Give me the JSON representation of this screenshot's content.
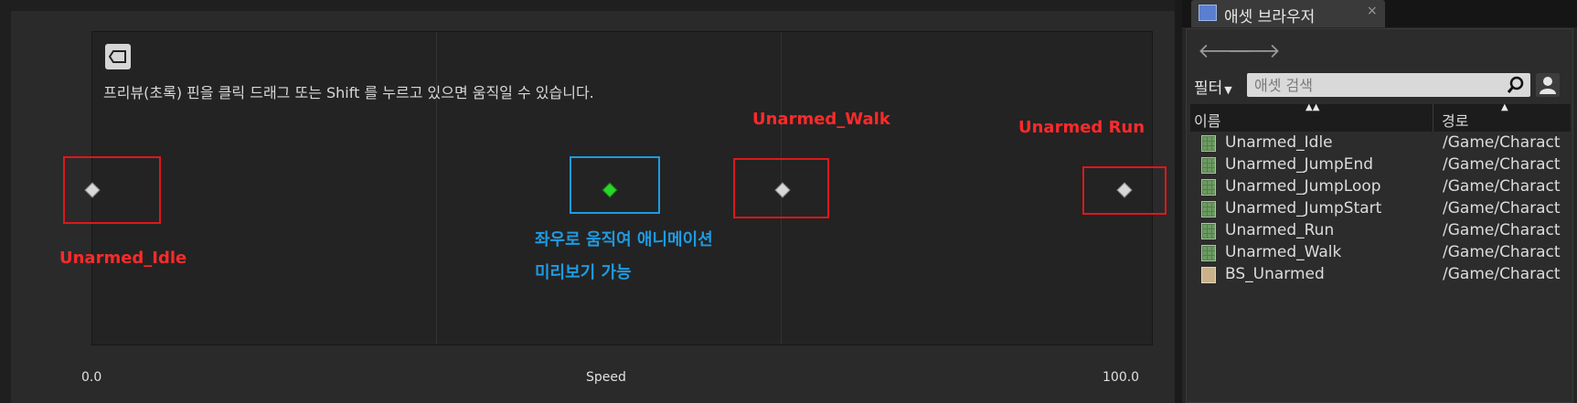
{
  "editor": {
    "hint_text": "프리뷰(초록) 핀을 클릭 드래그 또는 Shift 를 누르고 있으면 움직일 수 있습니다.",
    "hint_icon": "tag-icon",
    "axis": {
      "min_label": "0.0",
      "name": "Speed",
      "max_label": "100.0",
      "min": 0.0,
      "max": 100.0
    },
    "samples": [
      {
        "name": "Unarmed_Idle",
        "speed": 0
      },
      {
        "name": "Unarmed_Walk",
        "speed": 67
      },
      {
        "name": "Unarmed Run",
        "speed": 100
      }
    ],
    "preview_speed": 50,
    "annotations": {
      "idle": "Unarmed_Idle",
      "walk": "Unarmed_Walk",
      "run": "Unarmed Run",
      "preview_line1": "좌우로 움직여 애니메이션",
      "preview_line2": "미리보기 가능"
    },
    "colors": {
      "annotation_red": "#e0161c",
      "annotation_blue": "#1e9be2",
      "preview_pin": "#2ad62a"
    }
  },
  "asset_browser": {
    "tab_title": "애셋 브라우저",
    "tab_close": "×",
    "nav": {
      "back": "🡐",
      "forward": "🡒"
    },
    "filter_label": "필터",
    "search_placeholder": "애셋 검색",
    "columns": {
      "name": "이름",
      "path": "경로"
    },
    "assets": [
      {
        "name": "Unarmed_Idle",
        "path": "/Game/Charact",
        "icon": "animation-sequence-icon"
      },
      {
        "name": "Unarmed_JumpEnd",
        "path": "/Game/Charact",
        "icon": "animation-sequence-icon"
      },
      {
        "name": "Unarmed_JumpLoop",
        "path": "/Game/Charact",
        "icon": "animation-sequence-icon"
      },
      {
        "name": "Unarmed_JumpStart",
        "path": "/Game/Charact",
        "icon": "animation-sequence-icon"
      },
      {
        "name": "Unarmed_Run",
        "path": "/Game/Charact",
        "icon": "animation-sequence-icon"
      },
      {
        "name": "Unarmed_Walk",
        "path": "/Game/Charact",
        "icon": "animation-sequence-icon"
      },
      {
        "name": "BS_Unarmed",
        "path": "/Game/Charact",
        "icon": "blend-space-icon"
      }
    ]
  }
}
